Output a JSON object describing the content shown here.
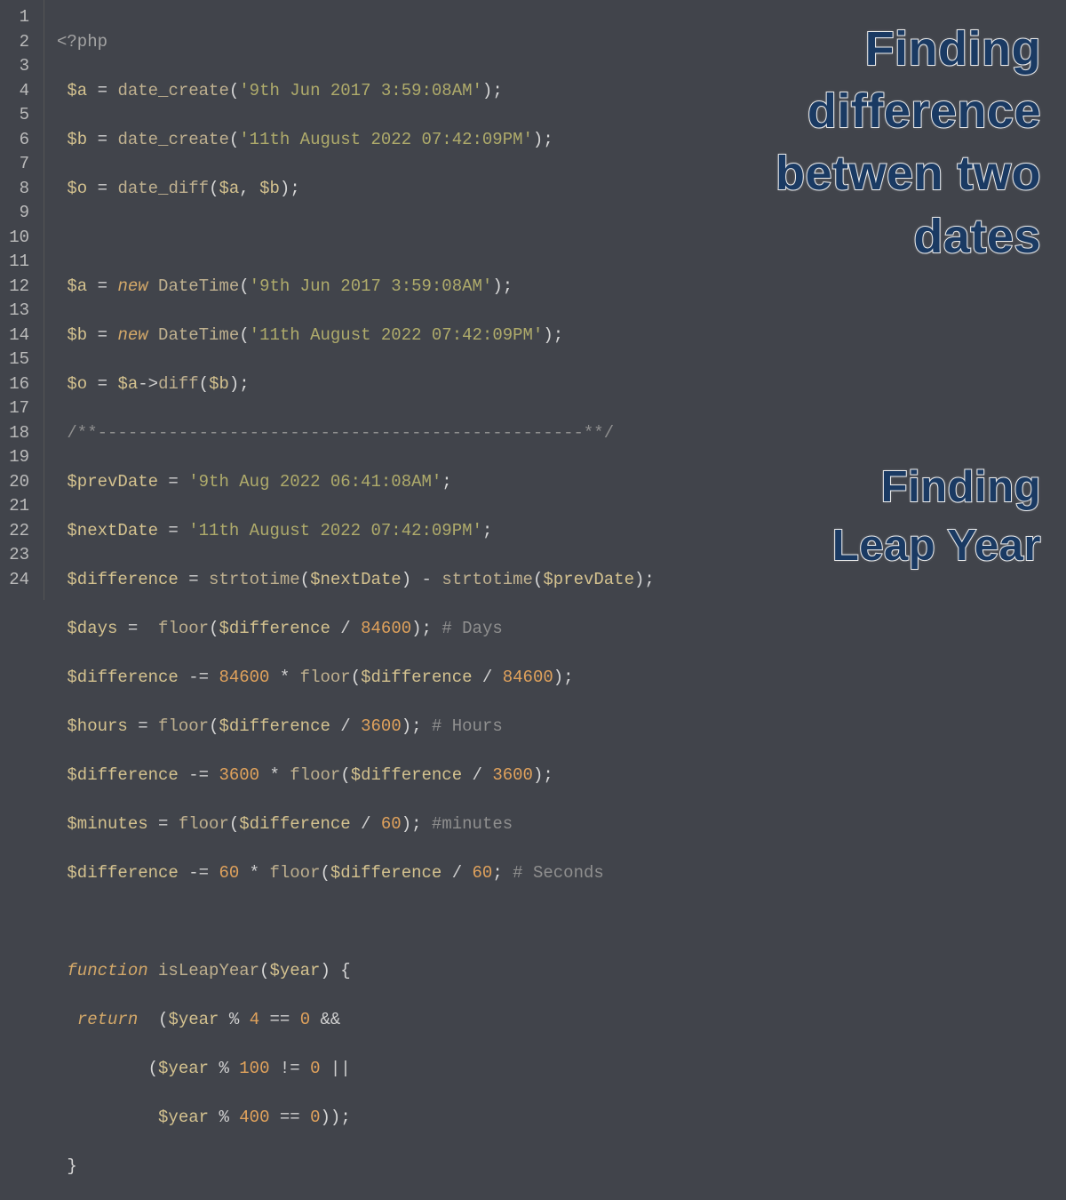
{
  "overlay1": {
    "l1": "Finding",
    "l2": "difference",
    "l3": "betwen two",
    "l4": "dates"
  },
  "overlay2": {
    "l1": "Finding",
    "l2": "Leap Year"
  },
  "gutter": [
    "1",
    "2",
    "3",
    "4",
    "5",
    "6",
    "7",
    "8",
    "9",
    "10",
    "11",
    "12",
    "13",
    "14",
    "15",
    "16",
    "17",
    "18",
    "19",
    "20",
    "21",
    "22",
    "23",
    "24"
  ],
  "t": {
    "php_open": "<?php",
    "a": "$a",
    "b": "$b",
    "o": "$o",
    "eq": " = ",
    "eqop": " == ",
    "neq": " != ",
    "and": " && ",
    "or": " || ",
    "minuseq": " -= ",
    "minus": " - ",
    "mul": " * ",
    "div": " / ",
    "mod": " % ",
    "semi": ";",
    "date_create": "date_create",
    "date_diff": "date_diff",
    "new": "new ",
    "datetime": "DateTime",
    "arrow": "->",
    "diff": "diff",
    "strA": "'9th Jun 2017 3:59:08AM'",
    "strB": "'11th August 2022 07:42:09PM'",
    "strC": "'9th Aug 2022 06:41:08AM'",
    "strD": "'11th August 2022 07:42:09PM'",
    "lp": "(",
    "rp": ")",
    "comma": ", ",
    "lb": " {",
    "rb": "}",
    "cmt_divider": "/**------------------------------------------------**/",
    "prevDate": "$prevDate",
    "nextDate": "$nextDate",
    "difference": "$difference",
    "strtotime": "strtotime",
    "days": "$days",
    "floor": "floor",
    "n84600": "84600",
    "n3600": "3600",
    "n60": "60",
    "n4": "4",
    "n100": "100",
    "n400": "400",
    "n0": "0",
    "c_days": " # Days",
    "c_hours": " # Hours",
    "c_minutes": " #minutes",
    "c_seconds": " # Seconds",
    "hours": "$hours",
    "minutes": "$minutes",
    "function": "function",
    "isLeapYear": " isLeapYear",
    "year": "$year",
    "return": "return",
    "sp1": " ",
    "sp2": "  ",
    "sp3": "   ",
    "sp9": "         ",
    "sp10": "          "
  }
}
